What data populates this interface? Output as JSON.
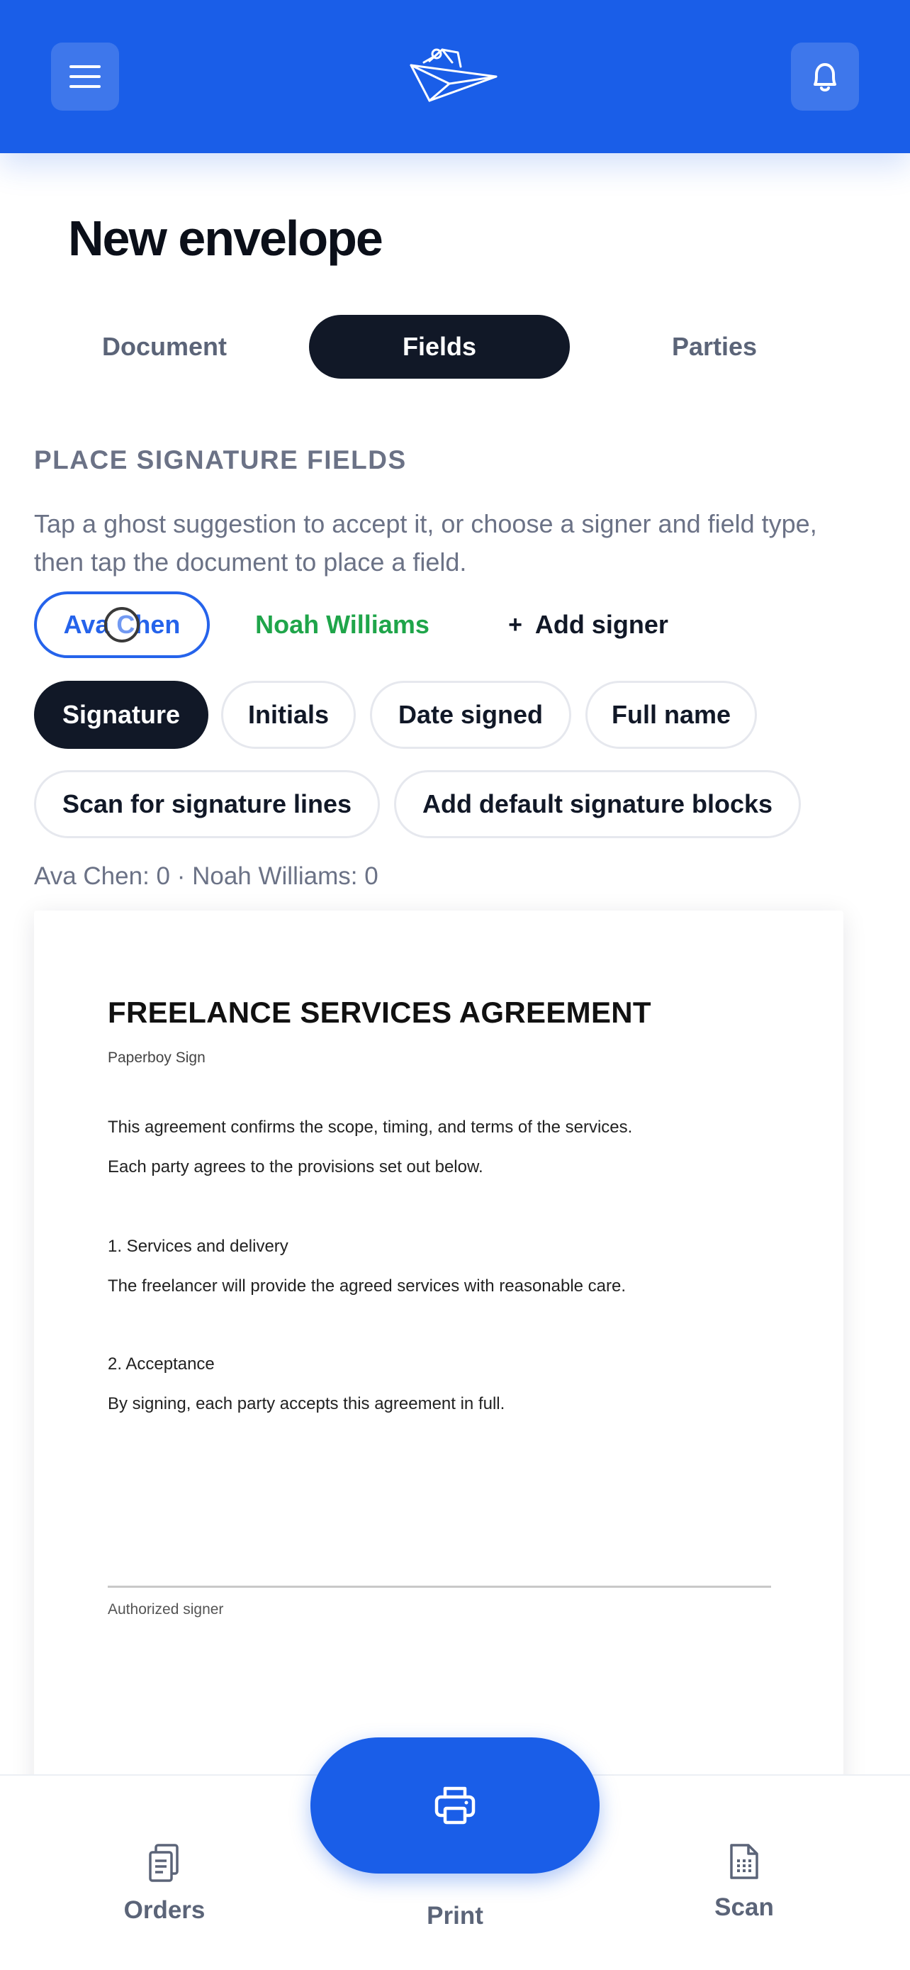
{
  "header": {
    "menu_icon": "hamburger-menu-icon",
    "logo_icon": "paper-plane-logo-icon",
    "bell_icon": "bell-icon",
    "brand_color": "#1a5ee8"
  },
  "page": {
    "title": "New envelope"
  },
  "tabs": [
    {
      "label": "Document",
      "active": false
    },
    {
      "label": "Fields",
      "active": true
    },
    {
      "label": "Parties",
      "active": false
    }
  ],
  "section": {
    "title": "PLACE SIGNATURE FIELDS",
    "help": "Tap a ghost suggestion to accept it, or choose a signer and field type, then tap the document to place a field."
  },
  "signers": {
    "items": [
      {
        "name": "Ava Chen",
        "selected": true,
        "color": "#2563eb"
      },
      {
        "name": "Noah Williams",
        "selected": false,
        "color": "#1fa54a"
      }
    ],
    "add_label": "Add signer",
    "add_symbol": "+"
  },
  "field_types": [
    {
      "label": "Signature",
      "active": true
    },
    {
      "label": "Initials",
      "active": false
    },
    {
      "label": "Date signed",
      "active": false
    },
    {
      "label": "Full name",
      "active": false
    }
  ],
  "actions": {
    "scan_label": "Scan for signature lines",
    "default_label": "Add default signature blocks"
  },
  "counts": "Ava Chen: 0 · Noah Williams: 0",
  "document": {
    "title": "FREELANCE SERVICES AGREEMENT",
    "subtitle": "Paperboy Sign",
    "intro_1": "This agreement confirms the scope, timing, and terms of the services.",
    "intro_2": "Each party agrees to the provisions set out below.",
    "section1_heading": "1. Services and delivery",
    "section1_body": "The freelancer will provide the agreed services with reasonable care.",
    "section2_heading": "2. Acceptance",
    "section2_body": "By signing, each party accepts this agreement in full.",
    "signature_caption": "Authorized signer"
  },
  "bottom_nav": {
    "orders_label": "Orders",
    "print_label": "Print",
    "scan_label": "Scan",
    "orders_icon": "clipboard-stack-icon",
    "print_icon": "printer-icon",
    "scan_icon": "scan-document-icon"
  }
}
